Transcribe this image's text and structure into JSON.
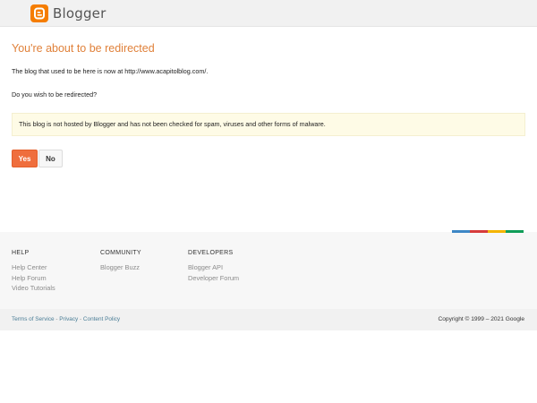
{
  "header": {
    "logo_text": "Blogger",
    "brand_color": "#f57d00"
  },
  "main": {
    "title": "You're about to be redirected",
    "message": "The blog that used to be here is now at http://www.acapitolblog.com/.",
    "question": "Do you wish to be redirected?",
    "warning": "This blog is not hosted by Blogger and has not been checked for spam, viruses and other forms of malware.",
    "yes_label": "Yes",
    "no_label": "No"
  },
  "footer": {
    "accent_colors": [
      "#3d87c6",
      "#d63b3b",
      "#f4b400",
      "#0f9d58"
    ],
    "columns": [
      {
        "title": "HELP",
        "links": [
          "Help Center",
          "Help Forum",
          "Video Tutorials"
        ]
      },
      {
        "title": "COMMUNITY",
        "links": [
          "Blogger Buzz"
        ]
      },
      {
        "title": "DEVELOPERS",
        "links": [
          "Blogger API",
          "Developer Forum"
        ]
      }
    ],
    "legal": {
      "terms": "Terms of Service",
      "privacy": "Privacy",
      "content_policy": "Content Policy",
      "separator": "-",
      "copyright": "Copyright © 1999 – 2021 Google"
    }
  }
}
